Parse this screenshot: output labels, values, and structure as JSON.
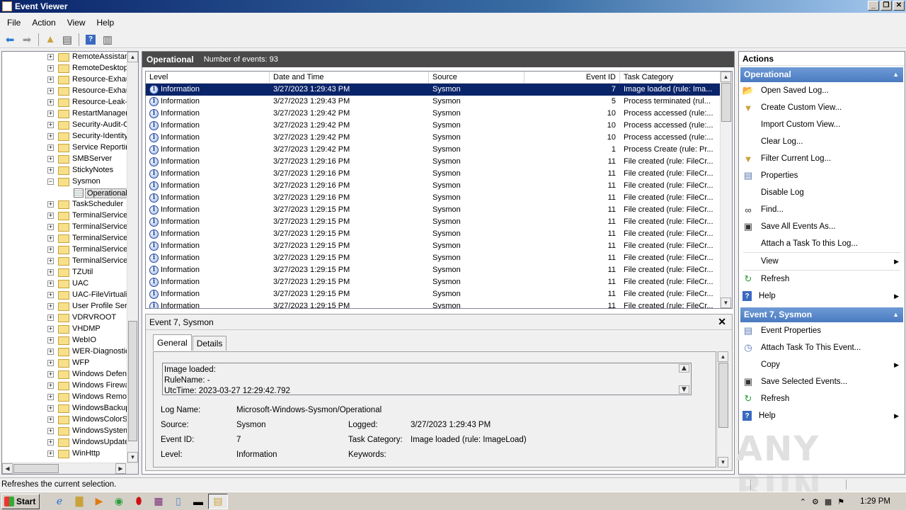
{
  "window": {
    "title": "Event Viewer"
  },
  "menu": [
    "File",
    "Action",
    "View",
    "Help"
  ],
  "tree": {
    "items": [
      {
        "label": "RemoteAssistan",
        "expander": "+"
      },
      {
        "label": "RemoteDesktop",
        "expander": "+"
      },
      {
        "label": "Resource-Exhau",
        "expander": "+"
      },
      {
        "label": "Resource-Exhau",
        "expander": "+"
      },
      {
        "label": "Resource-Leak-I",
        "expander": "+"
      },
      {
        "label": "RestartManager",
        "expander": "+"
      },
      {
        "label": "Security-Audit-C",
        "expander": "+"
      },
      {
        "label": "Security-Identity",
        "expander": "+"
      },
      {
        "label": "Service Reportin",
        "expander": "+"
      },
      {
        "label": "SMBServer",
        "expander": "+"
      },
      {
        "label": "StickyNotes",
        "expander": "+"
      },
      {
        "label": "Sysmon",
        "expander": "−"
      },
      {
        "label": "Operational",
        "expander": "",
        "selected": true
      },
      {
        "label": "TaskScheduler",
        "expander": "+"
      },
      {
        "label": "TerminalServices",
        "expander": "+"
      },
      {
        "label": "TerminalServices",
        "expander": "+"
      },
      {
        "label": "TerminalServices",
        "expander": "+"
      },
      {
        "label": "TerminalServices",
        "expander": "+"
      },
      {
        "label": "TerminalServices",
        "expander": "+"
      },
      {
        "label": "TZUtil",
        "expander": "+"
      },
      {
        "label": "UAC",
        "expander": "+"
      },
      {
        "label": "UAC-FileVirtualiz",
        "expander": "+"
      },
      {
        "label": "User Profile Serv",
        "expander": "+"
      },
      {
        "label": "VDRVROOT",
        "expander": "+"
      },
      {
        "label": "VHDMP",
        "expander": "+"
      },
      {
        "label": "WebIO",
        "expander": "+"
      },
      {
        "label": "WER-Diagnostic",
        "expander": "+"
      },
      {
        "label": "WFP",
        "expander": "+"
      },
      {
        "label": "Windows Defend",
        "expander": "+"
      },
      {
        "label": "Windows Firewa",
        "expander": "+"
      },
      {
        "label": "Windows Remot",
        "expander": "+"
      },
      {
        "label": "WindowsBackup",
        "expander": "+"
      },
      {
        "label": "WindowsColorSy",
        "expander": "+"
      },
      {
        "label": "WindowsSystem",
        "expander": "+"
      },
      {
        "label": "WindowsUpdate",
        "expander": "+"
      },
      {
        "label": "WinHttp",
        "expander": "+"
      }
    ]
  },
  "center": {
    "title": "Operational",
    "count_text": "Number of events: 93",
    "columns": [
      "Level",
      "Date and Time",
      "Source",
      "Event ID",
      "Task Category"
    ],
    "rows": [
      {
        "level": "Information",
        "datetime": "3/27/2023 1:29:43 PM",
        "source": "Sysmon",
        "id": "7",
        "category": "Image loaded (rule: Ima...",
        "selected": true
      },
      {
        "level": "Information",
        "datetime": "3/27/2023 1:29:43 PM",
        "source": "Sysmon",
        "id": "5",
        "category": "Process terminated (rul..."
      },
      {
        "level": "Information",
        "datetime": "3/27/2023 1:29:42 PM",
        "source": "Sysmon",
        "id": "10",
        "category": "Process accessed (rule:..."
      },
      {
        "level": "Information",
        "datetime": "3/27/2023 1:29:42 PM",
        "source": "Sysmon",
        "id": "10",
        "category": "Process accessed (rule:..."
      },
      {
        "level": "Information",
        "datetime": "3/27/2023 1:29:42 PM",
        "source": "Sysmon",
        "id": "10",
        "category": "Process accessed (rule:..."
      },
      {
        "level": "Information",
        "datetime": "3/27/2023 1:29:42 PM",
        "source": "Sysmon",
        "id": "1",
        "category": "Process Create (rule: Pr..."
      },
      {
        "level": "Information",
        "datetime": "3/27/2023 1:29:16 PM",
        "source": "Sysmon",
        "id": "11",
        "category": "File created (rule: FileCr..."
      },
      {
        "level": "Information",
        "datetime": "3/27/2023 1:29:16 PM",
        "source": "Sysmon",
        "id": "11",
        "category": "File created (rule: FileCr..."
      },
      {
        "level": "Information",
        "datetime": "3/27/2023 1:29:16 PM",
        "source": "Sysmon",
        "id": "11",
        "category": "File created (rule: FileCr..."
      },
      {
        "level": "Information",
        "datetime": "3/27/2023 1:29:16 PM",
        "source": "Sysmon",
        "id": "11",
        "category": "File created (rule: FileCr..."
      },
      {
        "level": "Information",
        "datetime": "3/27/2023 1:29:15 PM",
        "source": "Sysmon",
        "id": "11",
        "category": "File created (rule: FileCr..."
      },
      {
        "level": "Information",
        "datetime": "3/27/2023 1:29:15 PM",
        "source": "Sysmon",
        "id": "11",
        "category": "File created (rule: FileCr..."
      },
      {
        "level": "Information",
        "datetime": "3/27/2023 1:29:15 PM",
        "source": "Sysmon",
        "id": "11",
        "category": "File created (rule: FileCr..."
      },
      {
        "level": "Information",
        "datetime": "3/27/2023 1:29:15 PM",
        "source": "Sysmon",
        "id": "11",
        "category": "File created (rule: FileCr..."
      },
      {
        "level": "Information",
        "datetime": "3/27/2023 1:29:15 PM",
        "source": "Sysmon",
        "id": "11",
        "category": "File created (rule: FileCr..."
      },
      {
        "level": "Information",
        "datetime": "3/27/2023 1:29:15 PM",
        "source": "Sysmon",
        "id": "11",
        "category": "File created (rule: FileCr..."
      },
      {
        "level": "Information",
        "datetime": "3/27/2023 1:29:15 PM",
        "source": "Sysmon",
        "id": "11",
        "category": "File created (rule: FileCr..."
      },
      {
        "level": "Information",
        "datetime": "3/27/2023 1:29:15 PM",
        "source": "Sysmon",
        "id": "11",
        "category": "File created (rule: FileCr..."
      },
      {
        "level": "Information",
        "datetime": "3/27/2023 1:29:15 PM",
        "source": "Sysmon",
        "id": "11",
        "category": "File created (rule: FileCr..."
      }
    ]
  },
  "detail": {
    "title": "Event 7, Sysmon",
    "tabs": [
      "General",
      "Details"
    ],
    "message_lines": [
      "Image loaded:",
      "RuleName: -",
      "UtcTime: 2023-03-27 12:29:42.792"
    ],
    "log_name_label": "Log Name:",
    "log_name": "Microsoft-Windows-Sysmon/Operational",
    "source_label": "Source:",
    "source": "Sysmon",
    "logged_label": "Logged:",
    "logged": "3/27/2023 1:29:43 PM",
    "event_id_label": "Event ID:",
    "event_id": "7",
    "task_category_label": "Task Category:",
    "task_category": "Image loaded (rule: ImageLoad)",
    "level_label": "Level:",
    "level": "Information",
    "keywords_label": "Keywords:"
  },
  "actions": {
    "header": "Actions",
    "section1": "Operational",
    "items1": [
      {
        "label": "Open Saved Log...",
        "icon": "folder-open-icon"
      },
      {
        "label": "Create Custom View...",
        "icon": "filter-icon"
      },
      {
        "label": "Import Custom View...",
        "icon": ""
      },
      {
        "label": "Clear Log...",
        "icon": ""
      },
      {
        "label": "Filter Current Log...",
        "icon": "filter-icon"
      },
      {
        "label": "Properties",
        "icon": "properties-icon"
      },
      {
        "label": "Disable Log",
        "icon": ""
      },
      {
        "label": "Find...",
        "icon": "binoculars-icon"
      },
      {
        "label": "Save All Events As...",
        "icon": "save-icon"
      },
      {
        "label": "Attach a Task To this Log...",
        "icon": ""
      },
      {
        "label": "View",
        "icon": "",
        "submenu": true
      },
      {
        "label": "Refresh",
        "icon": "refresh-icon"
      },
      {
        "label": "Help",
        "icon": "help-icon",
        "submenu": true
      }
    ],
    "section2": "Event 7, Sysmon",
    "items2": [
      {
        "label": "Event Properties",
        "icon": "properties-icon"
      },
      {
        "label": "Attach Task To This Event...",
        "icon": "task-icon"
      },
      {
        "label": "Copy",
        "icon": "",
        "submenu": true
      },
      {
        "label": "Save Selected Events...",
        "icon": "save-icon"
      },
      {
        "label": "Refresh",
        "icon": "refresh-icon"
      },
      {
        "label": "Help",
        "icon": "help-icon",
        "submenu": true
      }
    ]
  },
  "watermark": "ANY RUN",
  "status": {
    "text": "Refreshes the current selection."
  },
  "taskbar": {
    "start": "Start",
    "clock": "1:29 PM"
  }
}
